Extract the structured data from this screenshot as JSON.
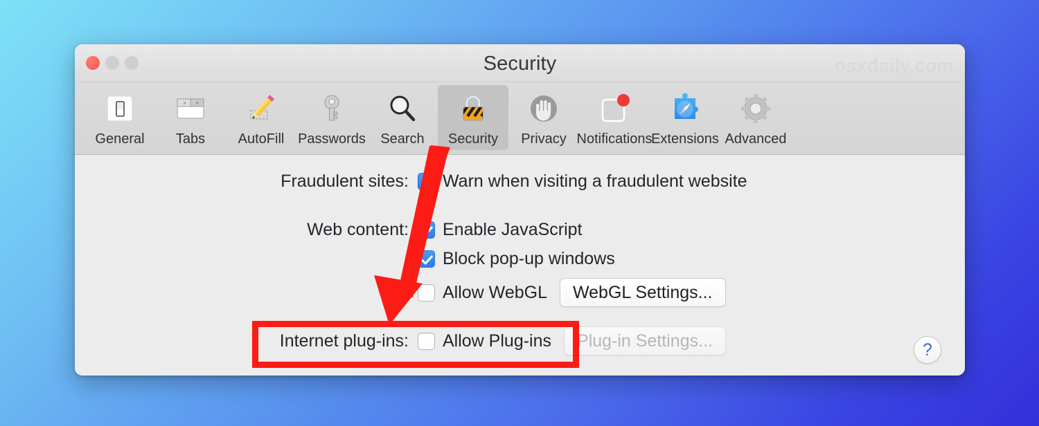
{
  "window": {
    "title": "Security",
    "watermark": "osxdaily.com",
    "traffic_lights": [
      "close",
      "minimize",
      "maximize"
    ]
  },
  "toolbar": {
    "items": [
      {
        "label": "General",
        "icon": "light-switch-icon",
        "selected": false
      },
      {
        "label": "Tabs",
        "icon": "browser-tabs-icon",
        "selected": false
      },
      {
        "label": "AutoFill",
        "icon": "pencil-icon",
        "selected": false
      },
      {
        "label": "Passwords",
        "icon": "key-icon",
        "selected": false
      },
      {
        "label": "Search",
        "icon": "magnifier-icon",
        "selected": false
      },
      {
        "label": "Security",
        "icon": "padlock-icon",
        "selected": true
      },
      {
        "label": "Privacy",
        "icon": "hand-stop-icon",
        "selected": false
      },
      {
        "label": "Notifications",
        "icon": "notification-badge-icon",
        "selected": false
      },
      {
        "label": "Extensions",
        "icon": "puzzle-compass-icon",
        "selected": false
      },
      {
        "label": "Advanced",
        "icon": "gear-icon",
        "selected": false
      }
    ]
  },
  "settings": {
    "fraudulent_sites": {
      "label": "Fraudulent sites:",
      "option_label": "Warn when visiting a fraudulent website",
      "checked": true
    },
    "web_content": {
      "label": "Web content:",
      "options": [
        {
          "option_label": "Enable JavaScript",
          "checked": true,
          "button": null
        },
        {
          "option_label": "Block pop-up windows",
          "checked": true,
          "button": null
        },
        {
          "option_label": "Allow WebGL",
          "checked": false,
          "button": "WebGL Settings...",
          "button_disabled": false
        }
      ]
    },
    "internet_plugins": {
      "label": "Internet plug-ins:",
      "option_label": "Allow Plug-ins",
      "checked": false,
      "button": "Plug-in Settings...",
      "button_disabled": true,
      "highlighted": true
    },
    "help_label": "?"
  },
  "annotations": {
    "highlight_color": "#fc1c15",
    "arrow_color": "#fc1c15",
    "arrow_from": "Security tab",
    "arrow_to": "Internet plug-ins row"
  },
  "colors": {
    "accent_blue": "#2d7ced",
    "toolbar_bg": "#d8d8d8",
    "content_bg": "#ececec",
    "background_gradient_start": "#7fe1f6",
    "background_gradient_end": "#3330da",
    "watermark_color": "#d9dade"
  }
}
